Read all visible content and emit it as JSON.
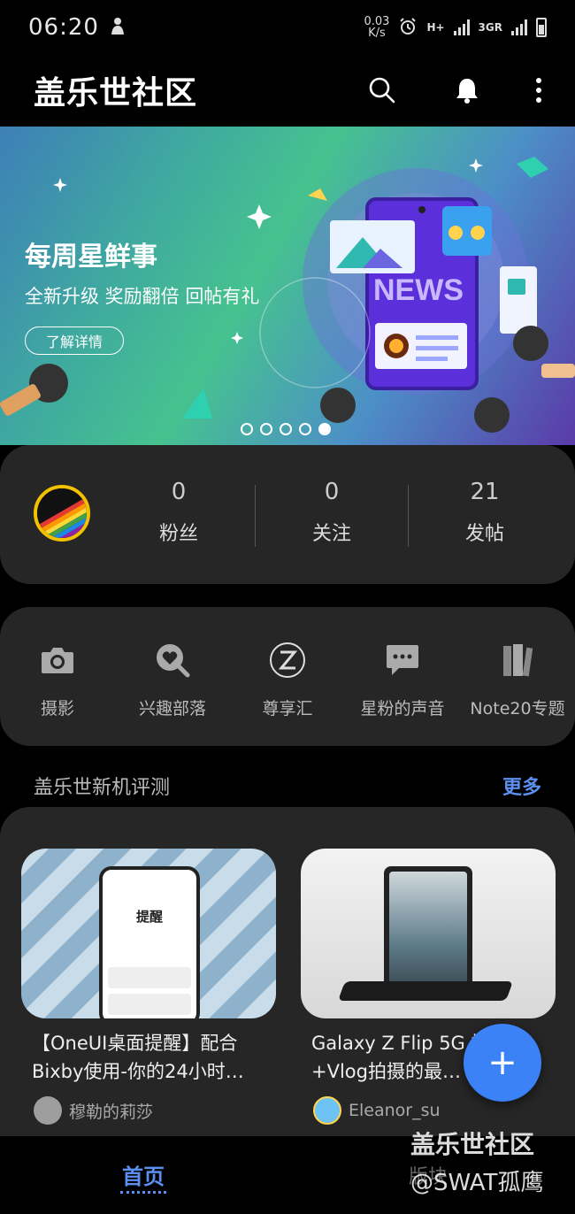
{
  "status_bar": {
    "time": "06:20",
    "net_speed_value": "0.03",
    "net_speed_unit": "K/s",
    "network_1": "H+",
    "network_2": "3GR"
  },
  "app_bar": {
    "title": "盖乐世社区",
    "icons": [
      "search-icon",
      "bell-icon",
      "more-vert-icon"
    ]
  },
  "banner": {
    "headline": "每周星鲜事",
    "subtitle": "全新升级 奖励翻倍 回帖有礼",
    "button_label": "了解详情",
    "illustration_text": "NEWS",
    "slide_count": 5,
    "active_slide": 5
  },
  "profile_stats": {
    "items": [
      {
        "value": "0",
        "label": "粉丝"
      },
      {
        "value": "0",
        "label": "关注"
      },
      {
        "value": "21",
        "label": "发帖"
      }
    ]
  },
  "quick_links": [
    {
      "label": "摄影",
      "icon": "camera-icon"
    },
    {
      "label": "兴趣部落",
      "icon": "heart-search-icon"
    },
    {
      "label": "尊享汇",
      "icon": "z-premium-icon"
    },
    {
      "label": "星粉的声音",
      "icon": "chat-bubble-icon"
    },
    {
      "label": "Note20专题",
      "icon": "books-icon"
    }
  ],
  "reviews_section": {
    "title": "盖乐世新机评测",
    "more_label": "更多",
    "cards": [
      {
        "title": "【OneUI桌面提醒】配合Bixby使用-你的24小时…",
        "author": "穆勒的莉莎",
        "screen_title": "提醒"
      },
      {
        "title": "Galaxy Z Flip 5G 摄影+Vlog拍摄的最…",
        "author": "Eleanor_su"
      }
    ]
  },
  "fab": {
    "label": "+"
  },
  "bottom_nav": {
    "home_label": "首页",
    "forum_label": "版块"
  },
  "watermark": {
    "line1": "盖乐世社区",
    "line2": "@SWAT孤鹰"
  },
  "colors": {
    "accent": "#5b8ff0",
    "fab": "#3b82f6",
    "card_bg": "#262626",
    "avatar_ring": "#f2c200"
  }
}
